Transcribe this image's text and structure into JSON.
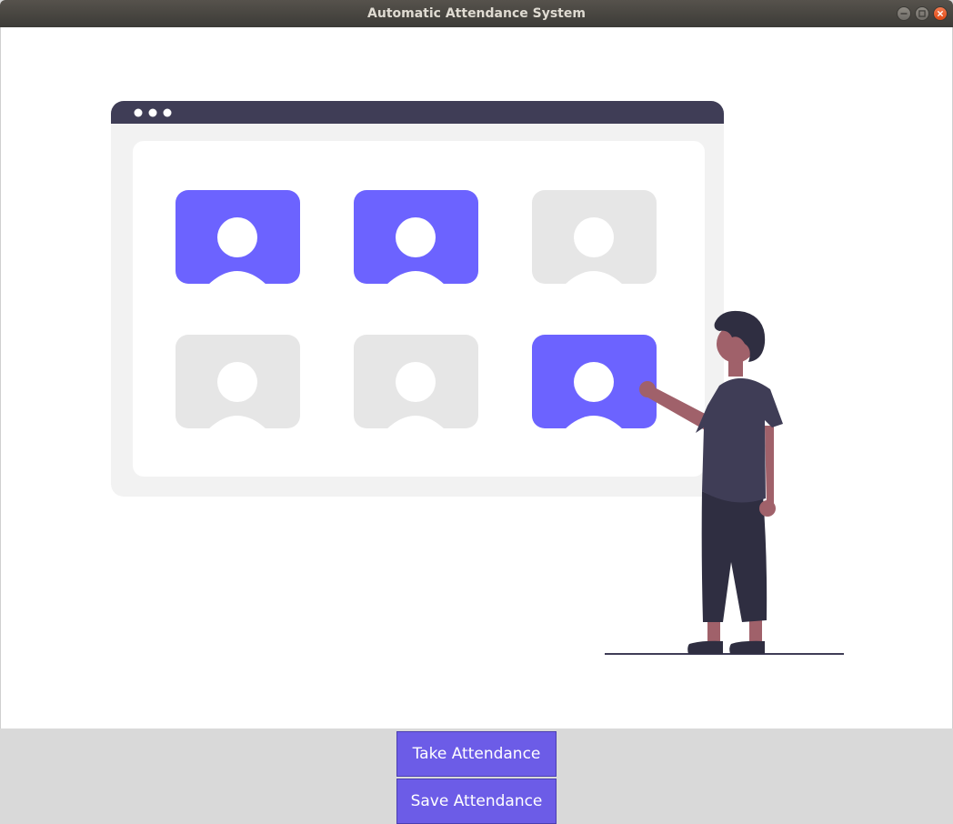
{
  "window": {
    "title": "Automatic Attendance System"
  },
  "controls": {
    "minimize_icon": "minimize-icon",
    "maximize_icon": "maximize-icon",
    "close_icon": "close-icon"
  },
  "illustration": {
    "description_icon": "attendance-illustration",
    "profiles": [
      {
        "state": "marked"
      },
      {
        "state": "marked"
      },
      {
        "state": "unmarked"
      },
      {
        "state": "unmarked"
      },
      {
        "state": "unmarked"
      },
      {
        "state": "marked"
      }
    ]
  },
  "actions": {
    "take_label": "Take Attendance",
    "save_label": "Save Attendance"
  },
  "colors": {
    "accent": "#6c63ff",
    "titlebar": "#3c3b37",
    "browser_bar": "#3f3d56",
    "card_off": "#e6e6e6",
    "panel": "#f2f2f2",
    "skin": "#a0616a",
    "dark": "#2f2e41"
  }
}
